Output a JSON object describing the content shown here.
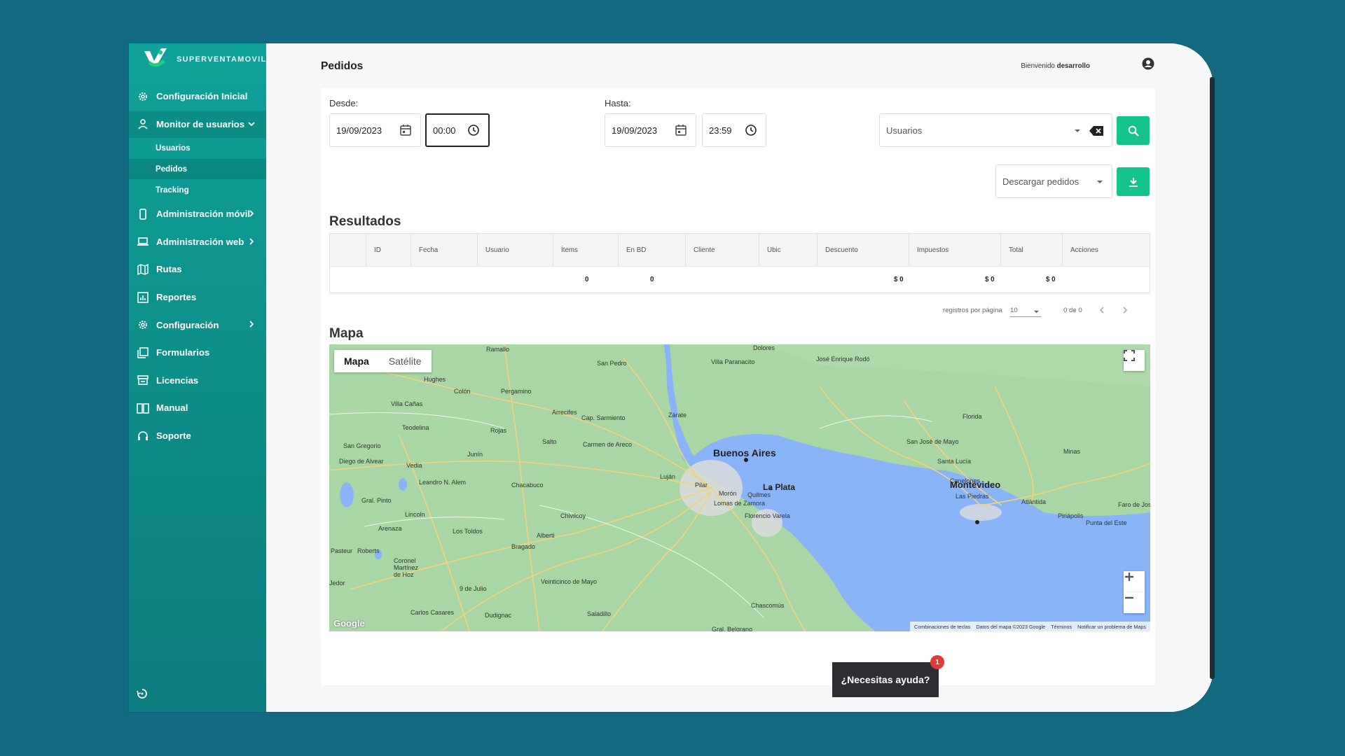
{
  "brand": {
    "name": "SUPERVENTAMOVIL"
  },
  "sidebar": {
    "items": [
      {
        "label": "Configuración Inicial",
        "icon": "gear-icon"
      },
      {
        "label": "Monitor de usuarios",
        "icon": "user-icon",
        "expanded": true
      },
      {
        "label": "Administración móvil",
        "icon": "phone-icon"
      },
      {
        "label": "Administración web",
        "icon": "laptop-icon"
      },
      {
        "label": "Rutas",
        "icon": "map-icon"
      },
      {
        "label": "Reportes",
        "icon": "chart-icon"
      },
      {
        "label": "Configuración",
        "icon": "gear-icon"
      },
      {
        "label": "Formularios",
        "icon": "forms-icon"
      },
      {
        "label": "Licencias",
        "icon": "license-icon"
      },
      {
        "label": "Manual",
        "icon": "book-icon"
      },
      {
        "label": "Soporte",
        "icon": "headset-icon"
      }
    ],
    "subitems": [
      {
        "label": "Usuarios"
      },
      {
        "label": "Pedidos",
        "active": true
      },
      {
        "label": "Tracking"
      }
    ]
  },
  "header": {
    "title": "Pedidos",
    "welcome_prefix": "Bienvenido",
    "welcome_user": "desarrollo"
  },
  "filters": {
    "desde_label": "Desde:",
    "desde_date": "19/09/2023",
    "desde_time": "00:00",
    "hasta_label": "Hasta:",
    "hasta_date": "19/09/2023",
    "hasta_time": "23:59",
    "usuarios_placeholder": "Usuarios",
    "descargar_label": "Descargar pedidos"
  },
  "results": {
    "title": "Resultados",
    "columns": [
      "ID",
      "Fecha",
      "Usuario",
      "Ítems",
      "En BD",
      "Cliente",
      "Ubic",
      "Descuento",
      "Impuestos",
      "Total",
      "Acciones"
    ],
    "totals": {
      "items": "0",
      "en_bd": "0",
      "descuento": "$ 0",
      "impuestos": "$ 0",
      "total": "$ 0"
    },
    "pager": {
      "per_page_label": "registros por página",
      "per_page": "10",
      "range": "0 de 0"
    }
  },
  "map": {
    "title": "Mapa",
    "toggle": {
      "map": "Mapa",
      "satellite": "Satélite"
    },
    "places_big": [
      "Buenos Aires",
      "La Plata",
      "Montevideo"
    ],
    "places": [
      "Ramallo",
      "San Pedro",
      "Villa Paranacito",
      "Dolores",
      "José Enrique Rodó",
      "Hughes",
      "Colón",
      "Pergamino",
      "Villa Cañas",
      "Arrecifes",
      "Cap. Sarmiento",
      "Zárate",
      "Teodelina",
      "Rojas",
      "Salto",
      "Carmen de Areco",
      "San Gregorio",
      "Diego de Alvear",
      "Vedia",
      "Junín",
      "Chacabuco",
      "Luján",
      "Leandro N. Alem",
      "Pilar",
      "Gral. Pinto",
      "Lincoln",
      "Chivilcoy",
      "Morón",
      "Quilmes",
      "Lomas de Zamora",
      "Florencio Varela",
      "Arenaza",
      "Los Toldos",
      "Alberti",
      "Bragado",
      "Pasteur",
      "Roberts",
      "Coronel Martínez de Hoz",
      "Veinticinco de Mayo",
      "9 de Julio",
      "Carlos Casares",
      "Dudignac",
      "Saladillo",
      "Chascomús",
      "Gral. Belgrano",
      "Florida",
      "San José de Mayo",
      "Santa Lucía",
      "Canelones",
      "Las Piedras",
      "Atlántida",
      "Minas",
      "Piriápolis",
      "Punta del Este",
      "Faro de José Ignacio",
      "Jedor"
    ],
    "footer": [
      "Combinaciones de teclas",
      "Datos del mapa ©2023 Google",
      "Términos",
      "Notificar un problema de Maps"
    ],
    "google": "Google"
  },
  "help": {
    "label": "¿Necesitas ayuda?",
    "badge": "1"
  },
  "colors": {
    "accent": "#14c48c",
    "sidebar": "#0fa29a",
    "background": "#13697f",
    "water": "#8ab4f8",
    "land": "#a8d5a2"
  }
}
